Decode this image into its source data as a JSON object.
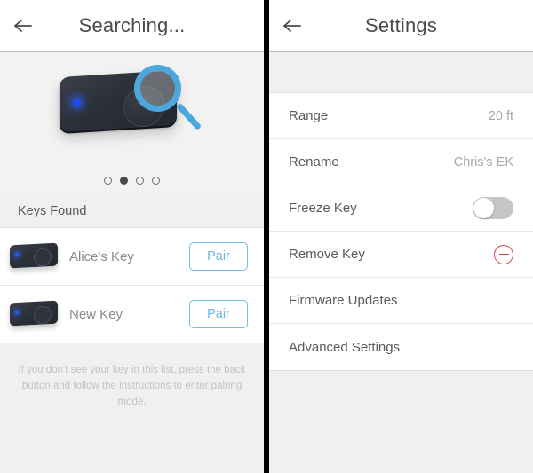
{
  "search_screen": {
    "header": {
      "back_icon": "arrow-left-icon",
      "title": "Searching..."
    },
    "hero": {
      "device_icon": "key-fob-device",
      "magnifier_icon": "magnifier-icon",
      "accent_color": "#4ba7dd",
      "led_color": "#2b5bf5",
      "pagination": {
        "count": 4,
        "active_index": 1
      }
    },
    "section_title": "Keys Found",
    "keys": [
      {
        "name": "Alice's Key",
        "action_label": "Pair",
        "icon": "key-fob-icon"
      },
      {
        "name": "New Key",
        "action_label": "Pair",
        "icon": "key-fob-icon"
      }
    ],
    "hint": "If you don't see your key in this list, press the back button and follow the instructions to enter pairing mode."
  },
  "settings_screen": {
    "header": {
      "back_icon": "arrow-left-icon",
      "title": "Settings"
    },
    "rows": [
      {
        "label": "Range",
        "value": "20 ft",
        "control": "value"
      },
      {
        "label": "Rename",
        "value": "Chris's EK",
        "control": "value"
      },
      {
        "label": "Freeze Key",
        "value": "",
        "control": "toggle",
        "toggle_on": false
      },
      {
        "label": "Remove Key",
        "value": "",
        "control": "remove",
        "icon": "minus-circle-icon",
        "icon_color": "#d0444a"
      },
      {
        "label": "Firmware Updates",
        "value": "",
        "control": "none"
      },
      {
        "label": "Advanced Settings",
        "value": "",
        "control": "none"
      }
    ]
  }
}
